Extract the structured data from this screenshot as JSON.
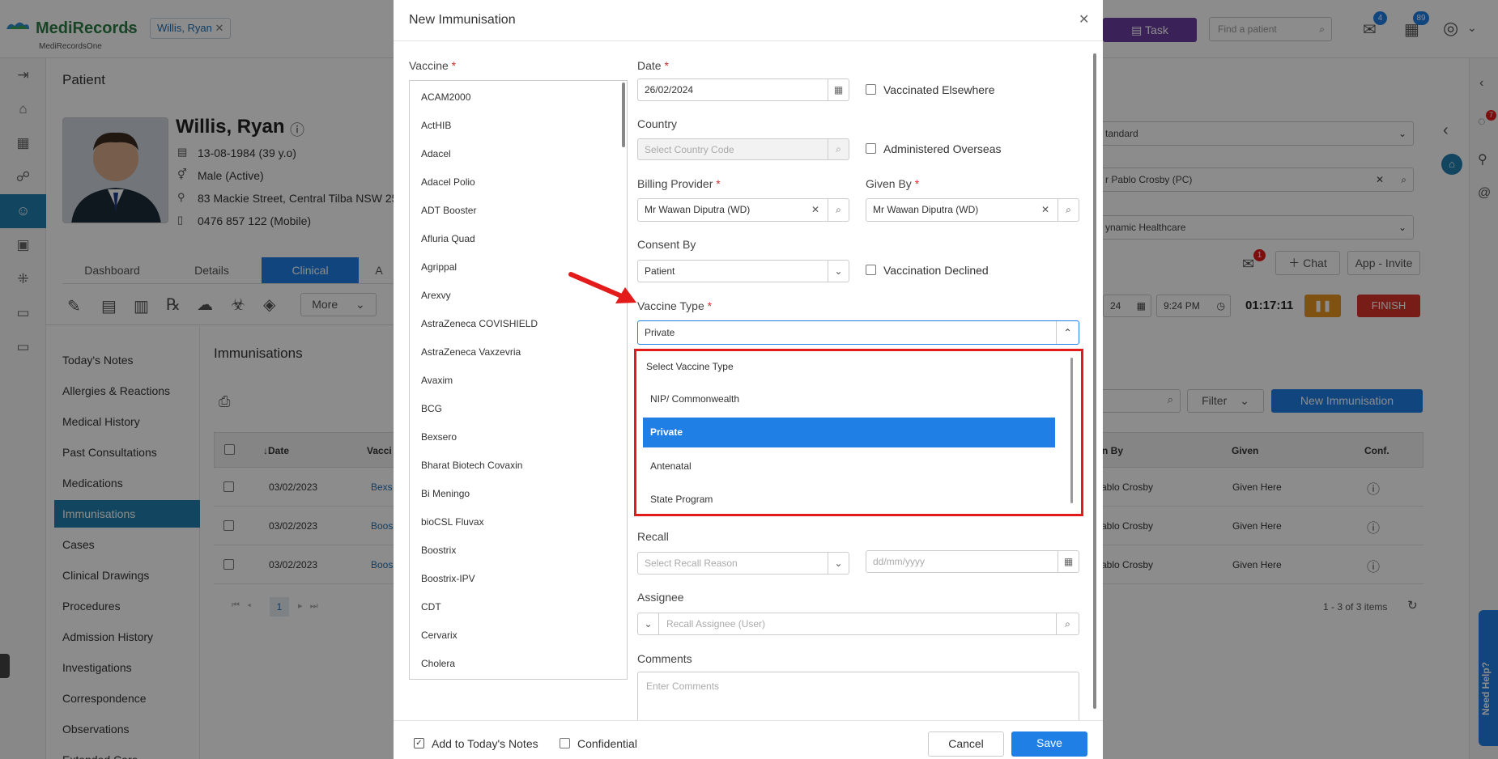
{
  "app": {
    "name": "MediRecords",
    "subtitle": "MediRecordsOne",
    "patient_chip": "Willis, Ryan",
    "task_label": "Task",
    "find_placeholder": "Find a patient",
    "mail_badge": "4",
    "calendar_badge": "89"
  },
  "page": {
    "section_title": "Patient",
    "patient": {
      "name": "Willis, Ryan",
      "dob": "13-08-1984 (39 y.o)",
      "gender": "Male (Active)",
      "address": "83 Mackie Street, Central Tilba NSW 25",
      "phone": "0476 857 122 (Mobile)"
    },
    "tabs": [
      "Dashboard",
      "Details",
      "Clinical",
      "A"
    ],
    "more_label": "More",
    "menu": [
      "Today's Notes",
      "Allergies & Reactions",
      "Medical History",
      "Past Consultations",
      "Medications",
      "Immunisations",
      "Cases",
      "Clinical Drawings",
      "Procedures",
      "Admission History",
      "Investigations",
      "Correspondence",
      "Observations",
      "Extended Care"
    ],
    "content_title": "Immunisations",
    "table": {
      "headers": [
        "Date",
        "Vacci",
        "n By",
        "Given",
        "Conf."
      ],
      "rows": [
        {
          "date": "03/02/2023",
          "vaccine": "Bexs",
          "by": "ablo Crosby",
          "given": "Given Here"
        },
        {
          "date": "03/02/2023",
          "vaccine": "Boos",
          "by": "ablo Crosby",
          "given": "Given Here"
        },
        {
          "date": "03/02/2023",
          "vaccine": "Boos",
          "by": "ablo Crosby",
          "given": "Given Here"
        }
      ],
      "pager_page": "1",
      "pager_summary": "1 - 3 of 3 items"
    },
    "filter_label": "Filter",
    "new_imm_label": "New Immunisation",
    "right": {
      "standard": "tandard",
      "practitioner": "r Pablo Crosby (PC)",
      "clinic": "ynamic Healthcare",
      "chat_label": "Chat",
      "app_invite_label": "App - Invite",
      "envelope_badge": "1",
      "date_partial": "24",
      "time": "9:24 PM",
      "timer": "01:17:11",
      "finish_label": "FINISH"
    },
    "side_badge": "7",
    "need_help": "Need Help?"
  },
  "modal": {
    "title": "New Immunisation",
    "vaccine_label": "Vaccine",
    "vaccines": [
      "ACAM2000",
      "ActHIB",
      "Adacel",
      "Adacel Polio",
      "ADT Booster",
      "Afluria Quad",
      "Agrippal",
      "Arexvy",
      "AstraZeneca COVISHIELD",
      "AstraZeneca Vaxzevria",
      "Avaxim",
      "BCG",
      "Bexsero",
      "Bharat Biotech Covaxin",
      "Bi Meningo",
      "bioCSL Fluvax",
      "Boostrix",
      "Boostrix-IPV",
      "CDT",
      "Cervarix",
      "Cholera"
    ],
    "date_label": "Date",
    "date_value": "26/02/2024",
    "vaccinated_elsewhere": "Vaccinated Elsewhere",
    "country_label": "Country",
    "country_placeholder": "Select Country Code",
    "administered_overseas": "Administered Overseas",
    "billing_label": "Billing Provider",
    "billing_value": "Mr Wawan Diputra (WD)",
    "given_by_label": "Given By",
    "given_by_value": "Mr Wawan Diputra (WD)",
    "consent_label": "Consent By",
    "consent_value": "Patient",
    "vaccination_declined": "Vaccination Declined",
    "vaccine_type_label": "Vaccine Type",
    "vaccine_type_value": "Private",
    "vaccine_type_options": [
      "Select Vaccine Type",
      "NIP/ Commonwealth",
      "Private",
      "Antenatal",
      "State Program"
    ],
    "vaccine_type_selected": "Private",
    "recall_label": "Recall",
    "recall_placeholder": "Select Recall Reason",
    "recall_date_placeholder": "dd/mm/yyyy",
    "assignee_label": "Assignee",
    "assignee_placeholder": "Recall Assignee (User)",
    "comments_label": "Comments",
    "comments_placeholder": "Enter Comments",
    "add_to_notes": "Add to Today's Notes",
    "confidential": "Confidential",
    "cancel_label": "Cancel",
    "save_label": "Save",
    "req_mark": "*"
  },
  "colors": {
    "primary": "#1f7fe5",
    "highlight_box": "#e31b1b",
    "task": "#6b3fa0",
    "finish": "#d9342b",
    "pause": "#e8961f"
  }
}
